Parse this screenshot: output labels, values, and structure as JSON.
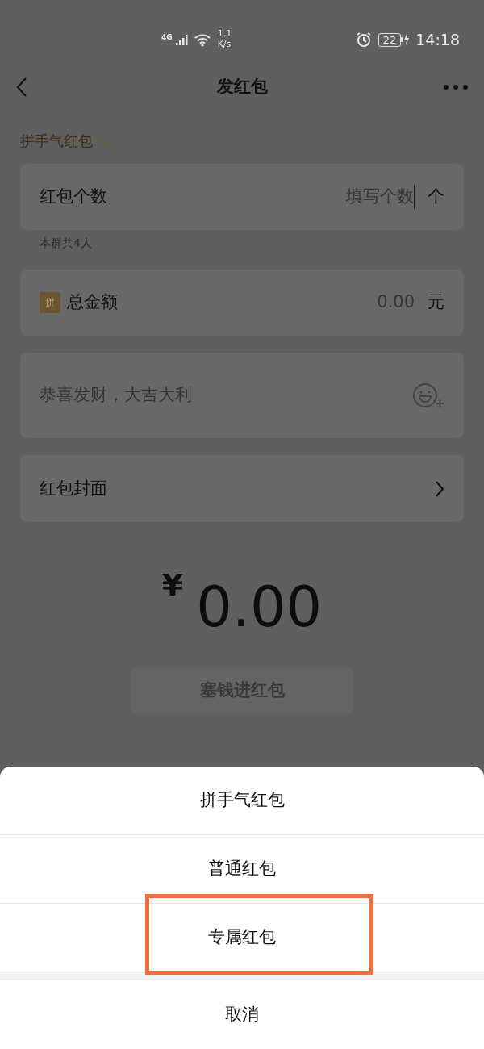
{
  "status_bar": {
    "network": "4G",
    "speed": [
      "1.1",
      "K/s"
    ],
    "battery": "22",
    "time": "14:18"
  },
  "nav": {
    "title": "发红包"
  },
  "packet_type": {
    "label": "拼手气红包"
  },
  "rows": [
    {
      "kind": "count",
      "label": "红包个数",
      "placeholder": "填写个数",
      "unit": "个",
      "note": "本群共4人"
    },
    {
      "kind": "amount",
      "badge": "拼",
      "label": "总金额",
      "placeholder": "0.00",
      "unit": "元"
    },
    {
      "kind": "message",
      "placeholder": "恭喜发财，大吉大利"
    },
    {
      "kind": "link",
      "label": "红包封面"
    }
  ],
  "total": {
    "currency": "¥",
    "amount": "0.00"
  },
  "submit": {
    "label": "塞钱进红包",
    "disabled": true
  },
  "sheet": {
    "options": [
      {
        "label": "拼手气红包",
        "highlighted": false
      },
      {
        "label": "普通红包",
        "highlighted": false
      },
      {
        "label": "专属红包",
        "highlighted": true
      }
    ],
    "cancel": "取消"
  }
}
